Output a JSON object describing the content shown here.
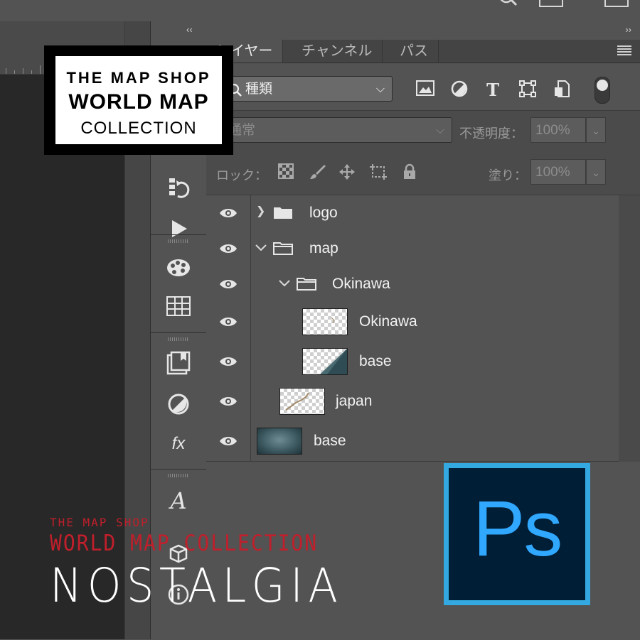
{
  "panel": {
    "collapse_left": "‹‹",
    "collapse_right": "››",
    "tabs": [
      {
        "label": "レイヤー",
        "active": true
      },
      {
        "label": "チャンネル",
        "active": false
      },
      {
        "label": "パス",
        "active": false
      }
    ],
    "filter_label": "種類",
    "blend_mode": "通常",
    "opacity_label": "不透明度：",
    "opacity_value": "100%",
    "lock_label": "ロック：",
    "fill_label": "塗り：",
    "fill_value": "100%"
  },
  "layers": [
    {
      "name": "logo",
      "type": "group",
      "expanded": false,
      "indent": 0
    },
    {
      "name": "map",
      "type": "group",
      "expanded": true,
      "indent": 0
    },
    {
      "name": "Okinawa",
      "type": "group",
      "expanded": true,
      "indent": 1
    },
    {
      "name": "Okinawa",
      "type": "layer",
      "indent": 2
    },
    {
      "name": "base",
      "type": "layer",
      "indent": 2
    },
    {
      "name": "japan",
      "type": "layer",
      "indent": 1
    },
    {
      "name": "base",
      "type": "layer",
      "indent": 0
    }
  ],
  "badge": {
    "line1": "THE MAP SHOP",
    "line2": "WORLD MAP",
    "line3": "COLLECTION"
  },
  "nostalgia": {
    "line1": "THE MAP SHOP",
    "line2": "WORLD MAP COLLECTION",
    "line3": "NOSTALGIA"
  },
  "ps_logo": {
    "text": "Ps",
    "border_color": "#34a9e1",
    "bg_color": "#001e36",
    "text_color": "#31a8ff"
  },
  "colors": {
    "panel_bg": "#535353",
    "canvas_bg": "#282828",
    "accent_red": "#c01f2b"
  }
}
